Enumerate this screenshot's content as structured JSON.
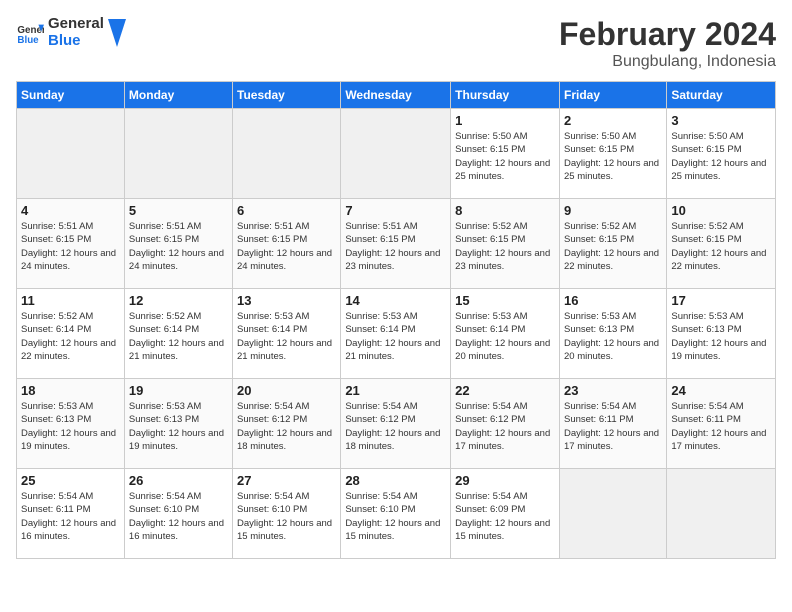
{
  "header": {
    "logo_line1": "General",
    "logo_line2": "Blue",
    "title": "February 2024",
    "subtitle": "Bungbulang, Indonesia"
  },
  "weekdays": [
    "Sunday",
    "Monday",
    "Tuesday",
    "Wednesday",
    "Thursday",
    "Friday",
    "Saturday"
  ],
  "weeks": [
    [
      {
        "day": "",
        "empty": true
      },
      {
        "day": "",
        "empty": true
      },
      {
        "day": "",
        "empty": true
      },
      {
        "day": "",
        "empty": true
      },
      {
        "day": "1",
        "sunrise": "5:50 AM",
        "sunset": "6:15 PM",
        "daylight": "12 hours and 25 minutes."
      },
      {
        "day": "2",
        "sunrise": "5:50 AM",
        "sunset": "6:15 PM",
        "daylight": "12 hours and 25 minutes."
      },
      {
        "day": "3",
        "sunrise": "5:50 AM",
        "sunset": "6:15 PM",
        "daylight": "12 hours and 25 minutes."
      }
    ],
    [
      {
        "day": "4",
        "sunrise": "5:51 AM",
        "sunset": "6:15 PM",
        "daylight": "12 hours and 24 minutes."
      },
      {
        "day": "5",
        "sunrise": "5:51 AM",
        "sunset": "6:15 PM",
        "daylight": "12 hours and 24 minutes."
      },
      {
        "day": "6",
        "sunrise": "5:51 AM",
        "sunset": "6:15 PM",
        "daylight": "12 hours and 24 minutes."
      },
      {
        "day": "7",
        "sunrise": "5:51 AM",
        "sunset": "6:15 PM",
        "daylight": "12 hours and 23 minutes."
      },
      {
        "day": "8",
        "sunrise": "5:52 AM",
        "sunset": "6:15 PM",
        "daylight": "12 hours and 23 minutes."
      },
      {
        "day": "9",
        "sunrise": "5:52 AM",
        "sunset": "6:15 PM",
        "daylight": "12 hours and 22 minutes."
      },
      {
        "day": "10",
        "sunrise": "5:52 AM",
        "sunset": "6:15 PM",
        "daylight": "12 hours and 22 minutes."
      }
    ],
    [
      {
        "day": "11",
        "sunrise": "5:52 AM",
        "sunset": "6:14 PM",
        "daylight": "12 hours and 22 minutes."
      },
      {
        "day": "12",
        "sunrise": "5:52 AM",
        "sunset": "6:14 PM",
        "daylight": "12 hours and 21 minutes."
      },
      {
        "day": "13",
        "sunrise": "5:53 AM",
        "sunset": "6:14 PM",
        "daylight": "12 hours and 21 minutes."
      },
      {
        "day": "14",
        "sunrise": "5:53 AM",
        "sunset": "6:14 PM",
        "daylight": "12 hours and 21 minutes."
      },
      {
        "day": "15",
        "sunrise": "5:53 AM",
        "sunset": "6:14 PM",
        "daylight": "12 hours and 20 minutes."
      },
      {
        "day": "16",
        "sunrise": "5:53 AM",
        "sunset": "6:13 PM",
        "daylight": "12 hours and 20 minutes."
      },
      {
        "day": "17",
        "sunrise": "5:53 AM",
        "sunset": "6:13 PM",
        "daylight": "12 hours and 19 minutes."
      }
    ],
    [
      {
        "day": "18",
        "sunrise": "5:53 AM",
        "sunset": "6:13 PM",
        "daylight": "12 hours and 19 minutes."
      },
      {
        "day": "19",
        "sunrise": "5:53 AM",
        "sunset": "6:13 PM",
        "daylight": "12 hours and 19 minutes."
      },
      {
        "day": "20",
        "sunrise": "5:54 AM",
        "sunset": "6:12 PM",
        "daylight": "12 hours and 18 minutes."
      },
      {
        "day": "21",
        "sunrise": "5:54 AM",
        "sunset": "6:12 PM",
        "daylight": "12 hours and 18 minutes."
      },
      {
        "day": "22",
        "sunrise": "5:54 AM",
        "sunset": "6:12 PM",
        "daylight": "12 hours and 17 minutes."
      },
      {
        "day": "23",
        "sunrise": "5:54 AM",
        "sunset": "6:11 PM",
        "daylight": "12 hours and 17 minutes."
      },
      {
        "day": "24",
        "sunrise": "5:54 AM",
        "sunset": "6:11 PM",
        "daylight": "12 hours and 17 minutes."
      }
    ],
    [
      {
        "day": "25",
        "sunrise": "5:54 AM",
        "sunset": "6:11 PM",
        "daylight": "12 hours and 16 minutes."
      },
      {
        "day": "26",
        "sunrise": "5:54 AM",
        "sunset": "6:10 PM",
        "daylight": "12 hours and 16 minutes."
      },
      {
        "day": "27",
        "sunrise": "5:54 AM",
        "sunset": "6:10 PM",
        "daylight": "12 hours and 15 minutes."
      },
      {
        "day": "28",
        "sunrise": "5:54 AM",
        "sunset": "6:10 PM",
        "daylight": "12 hours and 15 minutes."
      },
      {
        "day": "29",
        "sunrise": "5:54 AM",
        "sunset": "6:09 PM",
        "daylight": "12 hours and 15 minutes."
      },
      {
        "day": "",
        "empty": true
      },
      {
        "day": "",
        "empty": true
      }
    ]
  ],
  "labels": {
    "sunrise": "Sunrise:",
    "sunset": "Sunset:",
    "daylight": "Daylight:"
  }
}
